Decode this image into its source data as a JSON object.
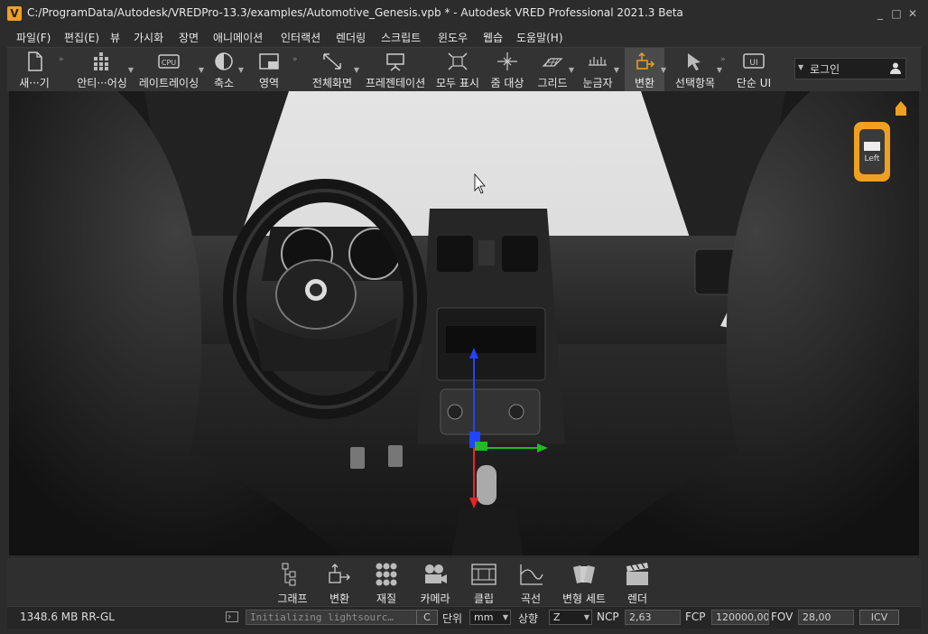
{
  "window": {
    "title": "C:/ProgramData/Autodesk/VREDPro-13.3/examples/Automotive_Genesis.vpb * - Autodesk VRED Professional 2021.3 Beta",
    "logo_letter": "V",
    "minimize": "_",
    "maximize": "□",
    "close": "✕"
  },
  "menu": [
    "파일(F)",
    "편집(E)",
    "뷰",
    "가시화",
    "장면",
    "애니메이션",
    "인터랙션",
    "렌더링",
    "스크립트",
    "윈도우",
    "웹습",
    "도움말(H)"
  ],
  "toolbar": {
    "new": "새···기",
    "interactive": "안티···어싱",
    "raytracing": "레이트레이싱",
    "axis": "축소",
    "region": "영역",
    "fullscreen": "전체화면",
    "presentation": "프레젠테이션",
    "show_all": "모두 표시",
    "zoom_target": "줌 대상",
    "grid": "그리드",
    "ruler": "눈금자",
    "transform": "변환",
    "select_items": "선택항목",
    "simple_ui": "단순 UI",
    "cpu_text": "CPU",
    "ui_text": "UI"
  },
  "login": {
    "label": "로그인"
  },
  "viewcube": {
    "label": "Left"
  },
  "bottom_tools": {
    "graph": "그래프",
    "transform": "변환",
    "material": "재질",
    "camera": "카메라",
    "clip": "클립",
    "curve": "곡선",
    "variant_set": "변형 세트",
    "render": "렌더"
  },
  "status": {
    "memory": "1348.6 MB",
    "renderer": "RR-GL",
    "message": "Initializing lightsourc…",
    "c_button": "C",
    "unit_label": "단위",
    "unit_value": "mm",
    "up_label": "상향",
    "up_value": "Z",
    "ncp_label": "NCP",
    "ncp_value": "2,63",
    "fcp_label": "FCP",
    "fcp_value": "120000,00",
    "fov_label": "FOV",
    "fov_value": "28,00",
    "icv_button": "ICV"
  },
  "colors": {
    "accent": "#f0a020",
    "gizmo_x": "#22bb22",
    "gizmo_y": "#2244ff",
    "gizmo_z": "#ee2222"
  }
}
